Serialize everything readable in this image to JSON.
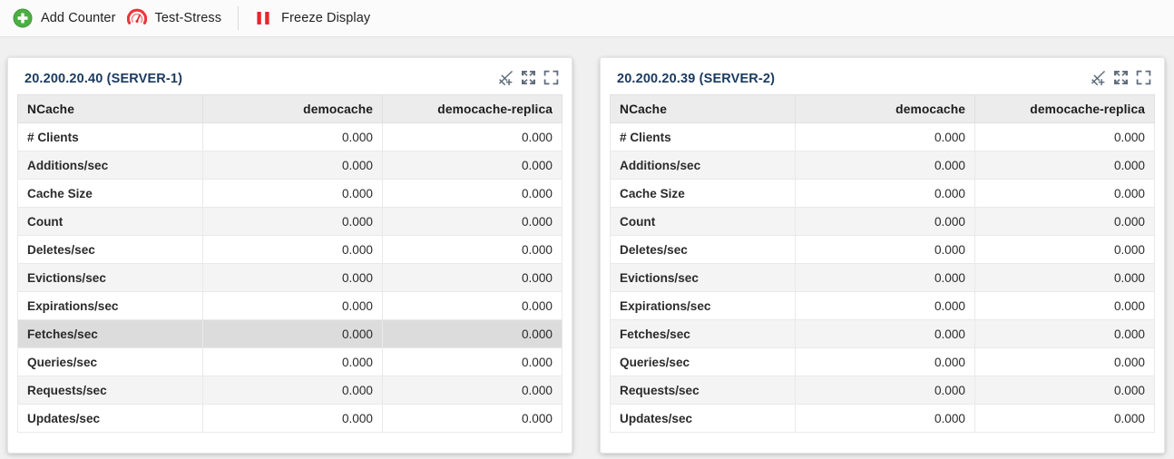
{
  "toolbar": {
    "buttons": [
      {
        "id": "add-counter",
        "label": "Add Counter",
        "icon": "plus-circle-icon",
        "color": "#4caf43"
      },
      {
        "id": "test-stress",
        "label": "Test-Stress",
        "icon": "gauge-icon",
        "color": "#e8262d"
      },
      {
        "id": "freeze-display",
        "label": "Freeze Display",
        "icon": "pause-icon",
        "color": "#e8262d"
      }
    ],
    "separator_after": 1
  },
  "panel_tools": [
    {
      "id": "chart-view",
      "icon": "graph-trend-icon",
      "title": "Graph"
    },
    {
      "id": "collapse",
      "icon": "collapse-arrows-icon",
      "title": "Collapse"
    },
    {
      "id": "fullscreen",
      "icon": "fullscreen-frame-icon",
      "title": "Fullscreen"
    }
  ],
  "columns": [
    "NCache",
    "democache",
    "democache-replica"
  ],
  "row_labels": [
    "# Clients",
    "Additions/sec",
    "Cache Size",
    "Count",
    "Deletes/sec",
    "Evictions/sec",
    "Expirations/sec",
    "Fetches/sec",
    "Queries/sec",
    "Requests/sec",
    "Updates/sec"
  ],
  "panels": [
    {
      "title": "20.200.20.40 (SERVER-1)",
      "hover_row": 7,
      "rows": [
        {
          "label": "# Clients",
          "democache": "0.000",
          "democache_replica": "0.000"
        },
        {
          "label": "Additions/sec",
          "democache": "0.000",
          "democache_replica": "0.000"
        },
        {
          "label": "Cache Size",
          "democache": "0.000",
          "democache_replica": "0.000"
        },
        {
          "label": "Count",
          "democache": "0.000",
          "democache_replica": "0.000"
        },
        {
          "label": "Deletes/sec",
          "democache": "0.000",
          "democache_replica": "0.000"
        },
        {
          "label": "Evictions/sec",
          "democache": "0.000",
          "democache_replica": "0.000"
        },
        {
          "label": "Expirations/sec",
          "democache": "0.000",
          "democache_replica": "0.000"
        },
        {
          "label": "Fetches/sec",
          "democache": "0.000",
          "democache_replica": "0.000"
        },
        {
          "label": "Queries/sec",
          "democache": "0.000",
          "democache_replica": "0.000"
        },
        {
          "label": "Requests/sec",
          "democache": "0.000",
          "democache_replica": "0.000"
        },
        {
          "label": "Updates/sec",
          "democache": "0.000",
          "democache_replica": "0.000"
        }
      ]
    },
    {
      "title": "20.200.20.39 (SERVER-2)",
      "hover_row": -1,
      "rows": [
        {
          "label": "# Clients",
          "democache": "0.000",
          "democache_replica": "0.000"
        },
        {
          "label": "Additions/sec",
          "democache": "0.000",
          "democache_replica": "0.000"
        },
        {
          "label": "Cache Size",
          "democache": "0.000",
          "democache_replica": "0.000"
        },
        {
          "label": "Count",
          "democache": "0.000",
          "democache_replica": "0.000"
        },
        {
          "label": "Deletes/sec",
          "democache": "0.000",
          "democache_replica": "0.000"
        },
        {
          "label": "Evictions/sec",
          "democache": "0.000",
          "democache_replica": "0.000"
        },
        {
          "label": "Expirations/sec",
          "democache": "0.000",
          "democache_replica": "0.000"
        },
        {
          "label": "Fetches/sec",
          "democache": "0.000",
          "democache_replica": "0.000"
        },
        {
          "label": "Queries/sec",
          "democache": "0.000",
          "democache_replica": "0.000"
        },
        {
          "label": "Requests/sec",
          "democache": "0.000",
          "democache_replica": "0.000"
        },
        {
          "label": "Updates/sec",
          "democache": "0.000",
          "democache_replica": "0.000"
        }
      ]
    }
  ],
  "colors": {
    "page_bg": "#f0f0f0",
    "toolbar_bg": "#fbfbfb",
    "panel_bg": "#ffffff",
    "title": "#1c3a5e",
    "header_bg": "#ececec",
    "stripe": "#f4f4f4",
    "hover": "#dcdcdc",
    "green": "#4caf43",
    "red": "#e8262d",
    "tool_icon": "#4b5a6b"
  }
}
